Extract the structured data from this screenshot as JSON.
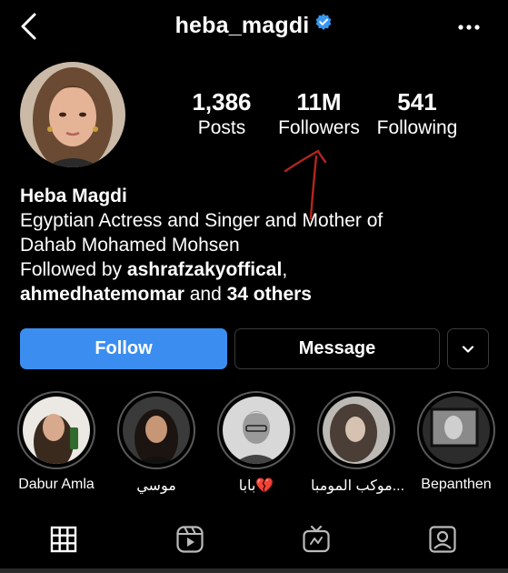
{
  "header": {
    "username": "heba_magdi",
    "verified": true,
    "back_icon": "chevron-left-icon",
    "more_icon": "more-horizontal-icon"
  },
  "stats": {
    "posts_count": "1,386",
    "posts_label": "Posts",
    "followers_count": "11M",
    "followers_label": "Followers",
    "following_count": "541",
    "following_label": "Following"
  },
  "bio": {
    "full_name": "Heba Magdi",
    "line1": "Egyptian Actress and Singer and Mother of",
    "line2": "Dahab Mohamed Mohsen",
    "followed_by_prefix": "Followed by ",
    "followed_by_user1": "ashrafzakyoffical",
    "followed_by_sep": ",",
    "followed_by_user2": "ahmedhatemomar",
    "followed_by_and": " and ",
    "followed_by_others": "34 others"
  },
  "actions": {
    "follow_label": "Follow",
    "message_label": "Message",
    "dropdown_icon": "chevron-down-icon"
  },
  "highlights": [
    {
      "label": "Dabur Amla"
    },
    {
      "label": "موسي"
    },
    {
      "label": "بابا💔"
    },
    {
      "label": "موكب المومبا..."
    },
    {
      "label": "Bepanthen"
    }
  ],
  "tabs": [
    {
      "icon": "grid-icon",
      "active": true
    },
    {
      "icon": "reels-icon",
      "active": false
    },
    {
      "icon": "igtv-icon",
      "active": false
    },
    {
      "icon": "tagged-icon",
      "active": false
    }
  ],
  "colors": {
    "follow_button": "#3b8ef0",
    "verified_badge": "#3897f0",
    "annotation_arrow": "#b3261e",
    "background": "#000000"
  }
}
